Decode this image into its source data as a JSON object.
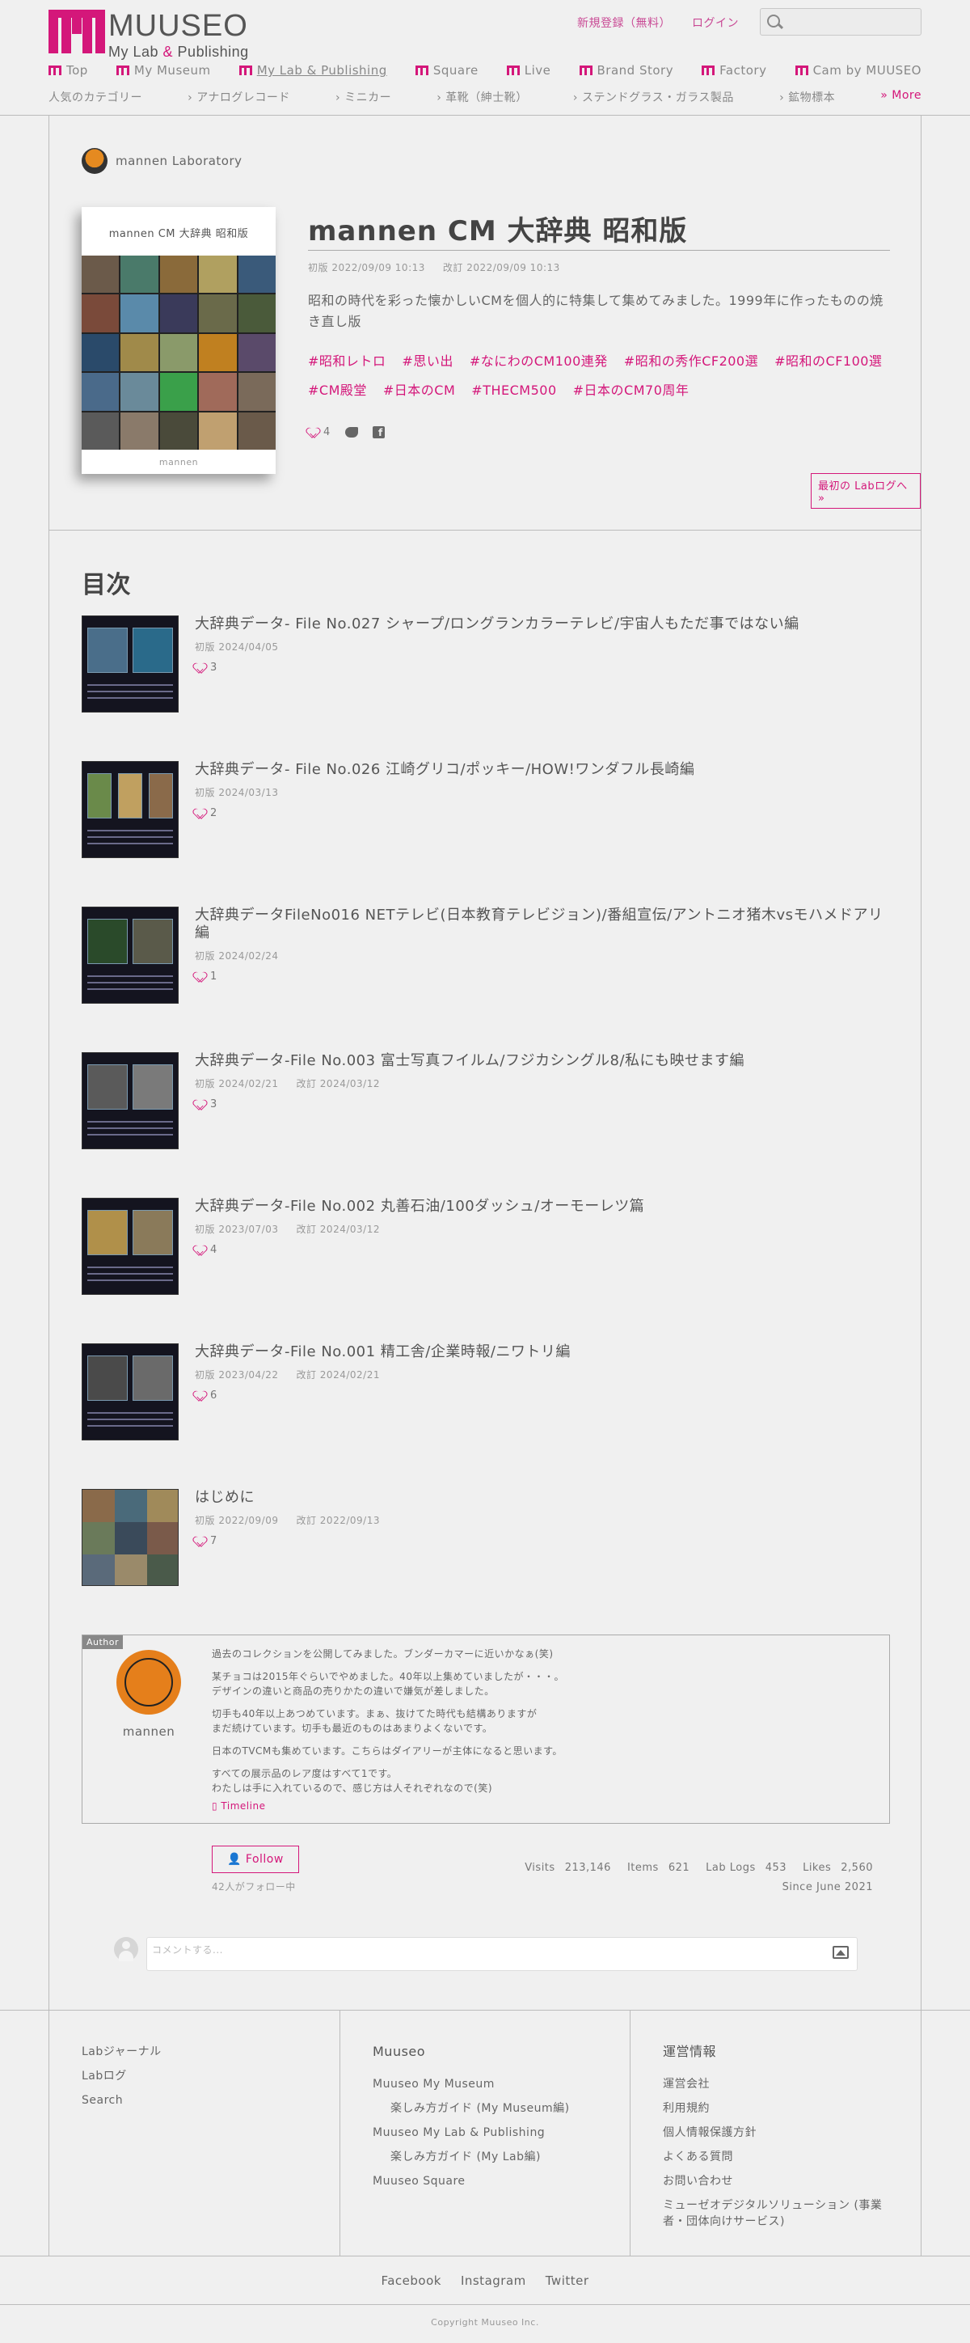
{
  "header": {
    "logo_title": "MUUSEO",
    "logo_sub_a": "My Lab ",
    "logo_sub_amp": "&",
    "logo_sub_b": " Publishing",
    "signup": "新規登録（無料）",
    "login": "ログイン",
    "search_placeholder": "",
    "accent_color": "#d4177a",
    "nav": [
      "Top",
      "My Museum",
      "My Lab & Publishing",
      "Square",
      "Live",
      "Brand Story",
      "Factory",
      "Cam by MUUSEO"
    ],
    "categories_label": "人気のカテゴリー",
    "categories": [
      "アナログレコード",
      "ミニカー",
      "革靴（紳士靴）",
      "ステンドグラス・ガラス製品",
      "鉱物標本"
    ],
    "more": "» More"
  },
  "lab": {
    "name": "mannen Laboratory",
    "book_title": "mannen CM 大辞典 昭和版",
    "book_author": "mannen",
    "title": "mannen CM 大辞典 昭和版",
    "published": "初版 2022/09/09 10:13",
    "revised": "改訂 2022/09/09 10:13",
    "description": "昭和の時代を彩った懐かしいCMを個人的に特集して集めてみました。1999年に作ったものの焼き直し版",
    "tags": [
      "#昭和レトロ",
      "#思い出",
      "#なにわのCM100連発",
      "#昭和の秀作CF200選",
      "#昭和のCF100選",
      "#CM殿堂",
      "#日本のCM",
      "#THECM500",
      "#日本のCM70周年"
    ],
    "likes": "4",
    "first_log": "最初の Labログへ »"
  },
  "toc": {
    "title": "目次",
    "items": [
      {
        "title": "大辞典データ- File No.027 シャープ/ロングランカラーテレビ/宇宙人もただ事ではない編",
        "published": "初版 2024/04/05",
        "revised": "",
        "likes": "3"
      },
      {
        "title": "大辞典データ- File No.026 江崎グリコ/ポッキー/HOW!ワンダフル長崎編",
        "published": "初版 2024/03/13",
        "revised": "",
        "likes": "2"
      },
      {
        "title": "大辞典データFileNo016 NETテレビ(日本教育テレビジョン)/番組宣伝/アントニオ猪木vsモハメドアリ編",
        "published": "初版 2024/02/24",
        "revised": "",
        "likes": "1"
      },
      {
        "title": "大辞典データ-File No.003 富士写真フイルム/フジカシングル8/私にも映せます編",
        "published": "初版 2024/02/21",
        "revised": "改訂 2024/03/12",
        "likes": "3"
      },
      {
        "title": "大辞典データ-File No.002 丸善石油/100ダッシュ/オーモーレツ篇",
        "published": "初版 2023/07/03",
        "revised": "改訂 2024/03/12",
        "likes": "4"
      },
      {
        "title": "大辞典データ-File No.001 精工舎/企業時報/ニワトリ編",
        "published": "初版 2023/04/22",
        "revised": "改訂 2024/02/21",
        "likes": "6"
      },
      {
        "title": "はじめに",
        "published": "初版 2022/09/09",
        "revised": "改訂 2022/09/13",
        "likes": "7"
      }
    ]
  },
  "author": {
    "tag": "Author",
    "name": "mannen",
    "bio": [
      "過去のコレクションを公開してみました。ブンダーカマーに近いかなぁ(笑)",
      "某チョコは2015年ぐらいでやめました。40年以上集めていましたが・・・。\nデザインの違いと商品の売りかたの違いで嫌気が差しました。",
      "切手も40年以上あつめています。まぁ、抜けてた時代も結構ありますが\nまだ続けています。切手も最近のものはあまりよくないです。",
      "日本のTVCMも集めています。こちらはダイアリーが主体になると思います。",
      "すべての展示品のレア度はすべて1です。\nわたしは手に入れているので、感じ方は人それぞれなので(笑)"
    ],
    "timeline": "Timeline",
    "follow": "Follow",
    "followers": "42人がフォロー中",
    "visits_label": "Visits",
    "visits": "213,146",
    "items_label": "Items",
    "items": "621",
    "lablogs_label": "Lab Logs",
    "lablogs": "453",
    "likes_label": "Likes",
    "likes": "2,560",
    "since": "Since June 2021"
  },
  "comment": {
    "placeholder": "コメントする..."
  },
  "footer": {
    "col1": [
      "Labジャーナル",
      "Labログ",
      "Search"
    ],
    "col2_title": "Muuseo",
    "col2": [
      "Muuseo My Museum",
      "楽しみ方ガイド (My Museum編)",
      "Muuseo My Lab & Publishing",
      "楽しみ方ガイド (My Lab編)",
      "Muuseo Square"
    ],
    "col3_title": "運営情報",
    "col3": [
      "運営会社",
      "利用規約",
      "個人情報保護方針",
      "よくある質問",
      "お問い合わせ",
      "ミューゼオデジタルソリューション (事業者・団体向けサービス)"
    ],
    "sns": [
      "Facebook",
      "Instagram",
      "Twitter"
    ],
    "copyright": "Copyright Muuseo Inc."
  }
}
